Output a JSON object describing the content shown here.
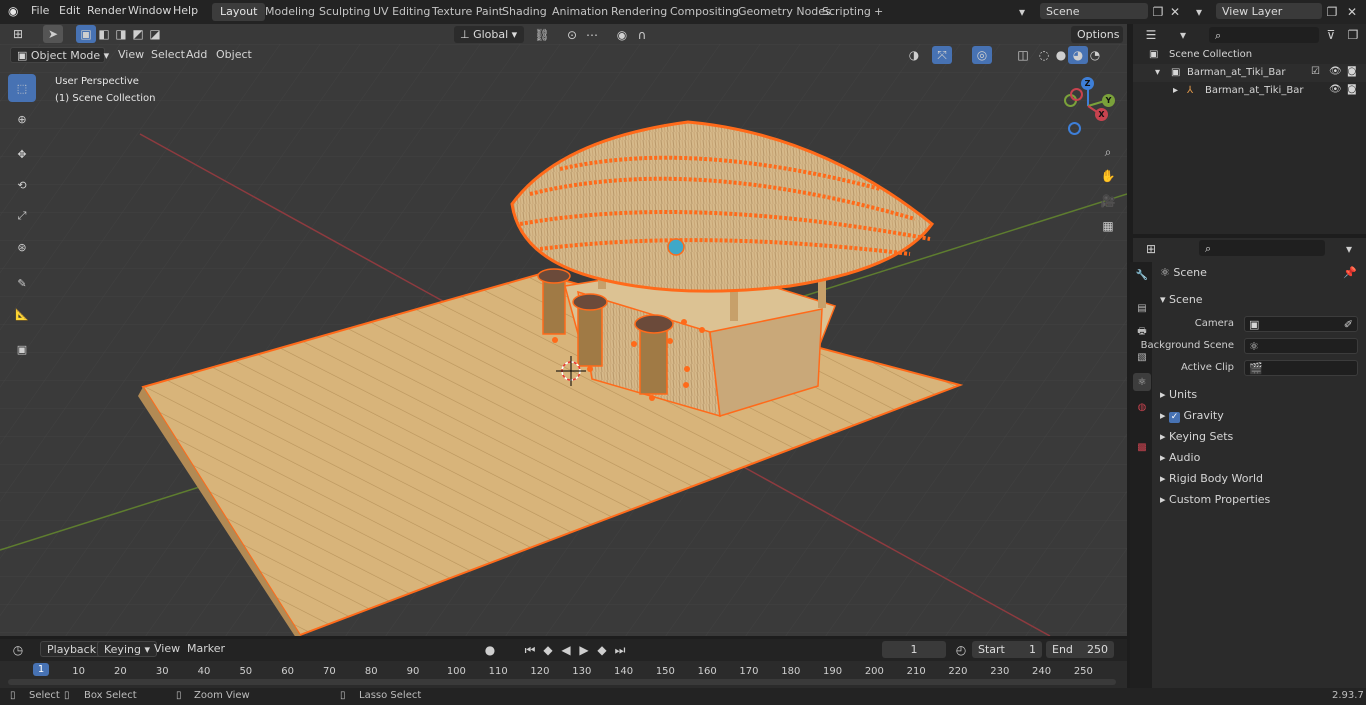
{
  "menu": {
    "file": "File",
    "edit": "Edit",
    "render": "Render",
    "window": "Window",
    "help": "Help"
  },
  "workspaces": [
    {
      "label": "Layout",
      "active": true
    },
    {
      "label": "Modeling"
    },
    {
      "label": "Sculpting"
    },
    {
      "label": "UV Editing"
    },
    {
      "label": "Texture Paint"
    },
    {
      "label": "Shading"
    },
    {
      "label": "Animation"
    },
    {
      "label": "Rendering"
    },
    {
      "label": "Compositing"
    },
    {
      "label": "Geometry Nodes"
    },
    {
      "label": "Scripting"
    }
  ],
  "add_workspace": "+",
  "scene_field": "Scene",
  "view_layer_field": "View Layer",
  "viewport_header": {
    "mode": "Object Mode",
    "view": "View",
    "select": "Select",
    "add": "Add",
    "object": "Object",
    "transform": "Global",
    "options": "Options"
  },
  "viewport_overlay": {
    "perspective": "User Perspective",
    "collection": "(1) Scene Collection"
  },
  "gizmo": {
    "x": "X",
    "y": "Y",
    "z": "Z"
  },
  "outliner": {
    "root": "Scene Collection",
    "items": [
      {
        "label": "Barman_at_Tiki_Bar",
        "level": 1
      },
      {
        "label": "Barman_at_Tiki_Bar",
        "level": 2
      }
    ]
  },
  "properties": {
    "context": "Scene",
    "panel_title": "Scene",
    "camera_label": "Camera",
    "background_scene_label": "Background Scene",
    "active_clip_label": "Active Clip",
    "subpanels": [
      "Units",
      "Gravity",
      "Keying Sets",
      "Audio",
      "Rigid Body World",
      "Custom Properties"
    ]
  },
  "timeline": {
    "playback": "Playback",
    "keying": "Keying",
    "view": "View",
    "marker": "Marker",
    "current_frame": "1",
    "start_label": "Start",
    "start_value": "1",
    "end_label": "End",
    "end_value": "250",
    "frames": [
      "1",
      "10",
      "20",
      "30",
      "40",
      "50",
      "60",
      "70",
      "80",
      "90",
      "100",
      "110",
      "120",
      "130",
      "140",
      "150",
      "160",
      "170",
      "180",
      "190",
      "200",
      "210",
      "220",
      "230",
      "240",
      "250"
    ]
  },
  "statusbar": {
    "select": "Select",
    "box_select": "Box Select",
    "zoom_view": "Zoom View",
    "lasso_select": "Lasso Select",
    "version": "2.93.7"
  },
  "colors": {
    "accent": "#4772b3",
    "selection_outline": "#ff6a1a",
    "axis_x": "#c8434f",
    "axis_y": "#7aa13a",
    "axis_z": "#3e7fd8"
  }
}
